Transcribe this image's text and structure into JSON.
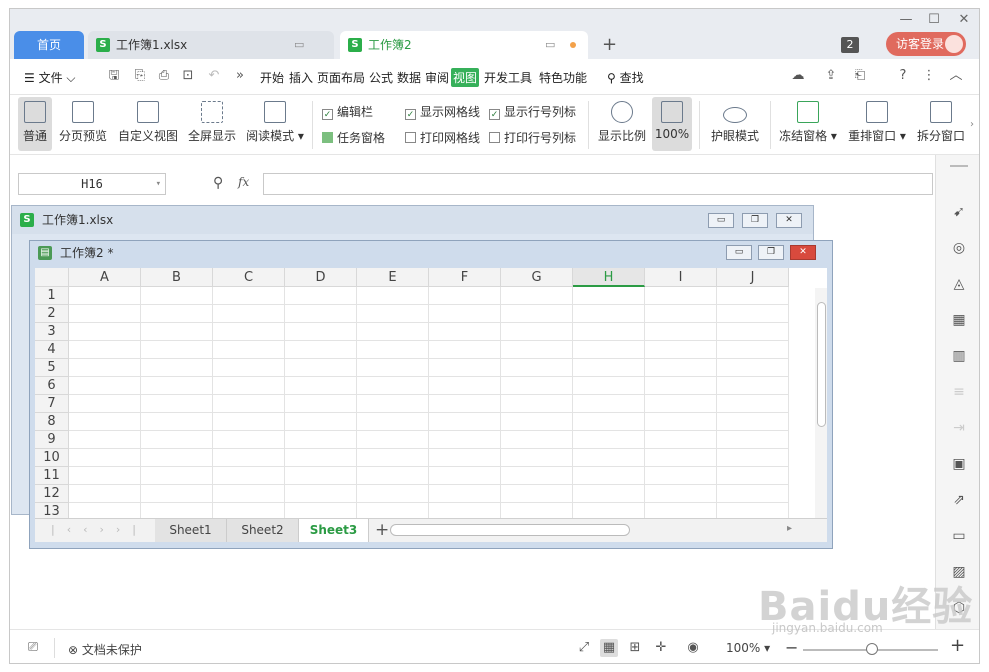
{
  "tabs": {
    "home": "首页",
    "doc1": "工作簿1.xlsx",
    "doc2": "工作簿2",
    "badge": "2",
    "login": "访客登录"
  },
  "menu": {
    "file": "文件",
    "items": [
      "开始",
      "插入",
      "页面布局",
      "公式",
      "数据",
      "审阅",
      "视图",
      "开发工具",
      "特色功能"
    ],
    "search": "查找"
  },
  "ribbon": {
    "normal": "普通",
    "page_break": "分页预览",
    "custom_view": "自定义视图",
    "fullscreen": "全屏显示",
    "read_mode": "阅读模式",
    "formula_bar": "编辑栏",
    "task_pane": "任务窗格",
    "show_grid": "显示网格线",
    "print_grid": "打印网格线",
    "show_rowcol": "显示行号列标",
    "print_rowcol": "打印行号列标",
    "zoom": "显示比例",
    "zoom_pct": "100%",
    "eye": "护眼模式",
    "freeze": "冻结窗格",
    "arrange": "重排窗口",
    "split": "拆分窗口"
  },
  "formula": {
    "cell": "H16",
    "fx": "fx"
  },
  "window1": {
    "title": "工作簿1.xlsx"
  },
  "window2": {
    "title": "工作簿2 *",
    "columns": [
      "A",
      "B",
      "C",
      "D",
      "E",
      "F",
      "G",
      "H",
      "I",
      "J"
    ],
    "rows": [
      "1",
      "2",
      "3",
      "4",
      "5",
      "6",
      "7",
      "8",
      "9",
      "10",
      "11",
      "12",
      "13"
    ],
    "selected_column": "H",
    "sheets": [
      "Sheet1",
      "Sheet2",
      "Sheet3"
    ],
    "active_sheet": "Sheet3"
  },
  "status": {
    "protect": "文档未保护",
    "zoom": "100%"
  },
  "watermark": {
    "logo": "Baidu经验",
    "url": "jingyan.baidu.com"
  }
}
